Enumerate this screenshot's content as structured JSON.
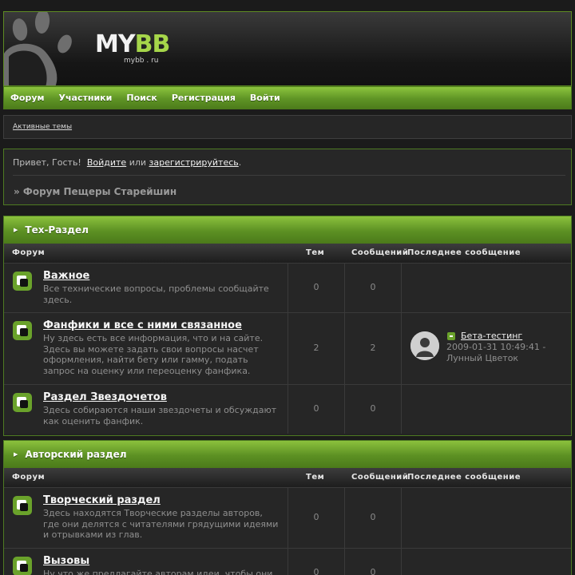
{
  "header": {
    "logo_my": "MY",
    "logo_bb": "BB",
    "logo_sub": "mybb . ru"
  },
  "nav": {
    "items": [
      "Форум",
      "Участники",
      "Поиск",
      "Регистрация",
      "Войти"
    ]
  },
  "subbar": {
    "active_topics": "Активные темы"
  },
  "welcome": {
    "greeting": "Привет, Гость!",
    "login": "Войдите",
    "or": "или",
    "register": "зарегистрируйтесь",
    "period": ".",
    "breadcrumb": "» Форум Пещеры Старейшин"
  },
  "columns": {
    "forum": "Форум",
    "topics": "Тем",
    "posts": "Сообщений",
    "last_post": "Последнее сообщение"
  },
  "categories": [
    {
      "title": "Тех-Раздел",
      "forums": [
        {
          "title": "Важное",
          "desc_lines": [
            "Все технические вопросы, проблемы сообщайте",
            "здесь."
          ],
          "topics": "0",
          "posts": "0"
        },
        {
          "title": "Фанфики и все с ними связанное",
          "desc_lines": [
            "Ну здесь есть все информация, что и на сайте.",
            "Здесь вы можете задать свои вопросы насчет",
            "оформления, найти бету или гамму, подать",
            "запрос на оценку или переоценку фанфика."
          ],
          "topics": "2",
          "posts": "2",
          "last_post": {
            "title": "Бета-тестинг",
            "date": "2009-01-31 10:49:41 -",
            "author": "Лунный Цветок"
          }
        },
        {
          "title": "Раздел Звездочетов",
          "desc_lines": [
            "Здесь собираются наши звездочеты и обсуждают",
            "как оценить фанфик."
          ],
          "topics": "0",
          "posts": "0"
        }
      ]
    },
    {
      "title": "Авторский раздел",
      "forums": [
        {
          "title": "Творческий раздел",
          "desc_lines": [
            "Здесь находятся Творческие разделы авторов,",
            "где они делятся с читателями грядущими идеями",
            "и отрывками из глав."
          ],
          "topics": "0",
          "posts": "0"
        },
        {
          "title": "Вызовы",
          "desc_lines": [
            "Ну что же предлагайте авторам идеи, чтобы они"
          ],
          "topics": "0",
          "posts": "0"
        }
      ]
    }
  ],
  "colors": {
    "accent_green": "#6aa22b",
    "border_green": "#4e7a22",
    "logo_green": "#a6d64a",
    "background": "#1b1b1b"
  }
}
